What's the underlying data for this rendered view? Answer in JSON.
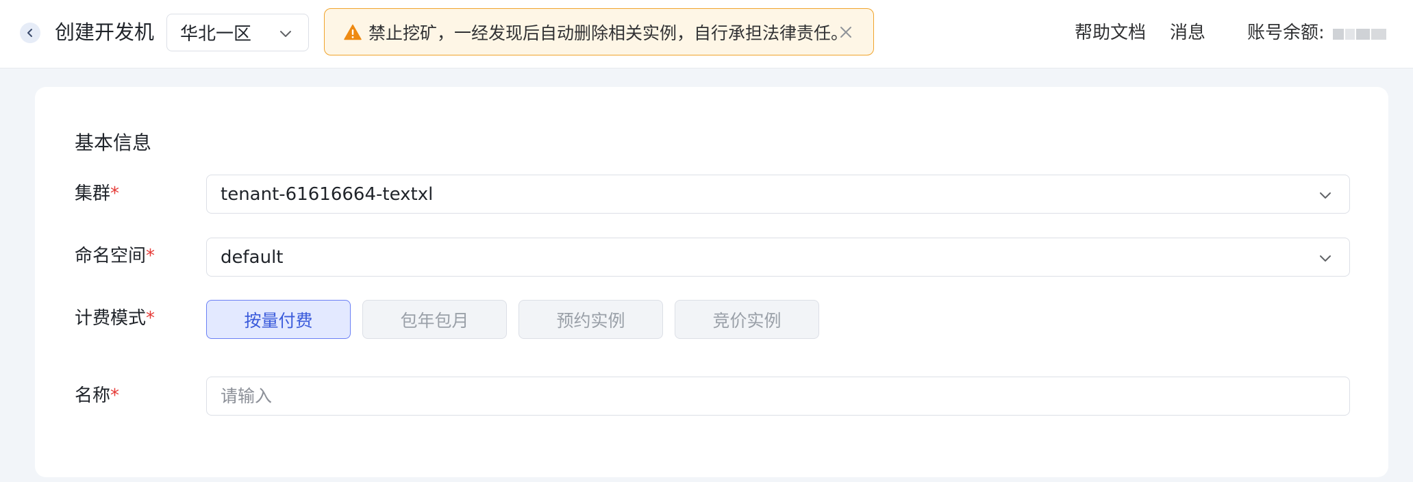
{
  "header": {
    "title": "创建开发机",
    "region": "华北一区",
    "warning": "禁止挖矿，一经发现后自动删除相关实例，自行承担法律责任。",
    "help_docs": "帮助文档",
    "messages": "消息",
    "balance_label": "账号余额:"
  },
  "card": {
    "section_title": "基本信息",
    "cluster": {
      "label": "集群",
      "required": "*",
      "value": "tenant-61616664-textxl"
    },
    "namespace": {
      "label": "命名空间",
      "required": "*",
      "value": "default"
    },
    "billing": {
      "label": "计费模式",
      "required": "*",
      "options": [
        "按量付费",
        "包年包月",
        "预约实例",
        "竞价实例"
      ],
      "selected": "按量付费"
    },
    "name": {
      "label": "名称",
      "required": "*",
      "placeholder": "请输入"
    }
  },
  "colors": {
    "accent": "#3b5bdb",
    "warning_border": "#f0a32a",
    "warning_bg": "#fef6e6",
    "required": "#e53935"
  },
  "icons": [
    "chevron-left-icon",
    "chevron-down-icon",
    "warning-icon",
    "close-icon"
  ]
}
